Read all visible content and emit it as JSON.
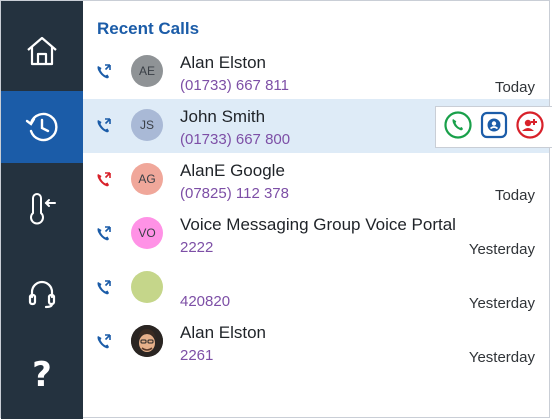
{
  "sidebar": {
    "items": [
      {
        "icon": "home-icon"
      },
      {
        "icon": "recent-calls-icon",
        "active": true
      },
      {
        "icon": "thermometer-icon"
      },
      {
        "icon": "headset-icon"
      },
      {
        "icon": "help-icon",
        "label": "?"
      }
    ]
  },
  "main": {
    "title": "Recent Calls",
    "calls": [
      {
        "name": "Alan Elston",
        "number": "(01733) 667 811",
        "when": "Today",
        "initials": "AE",
        "avatar_color": "#8f9396",
        "direction": "incoming",
        "icon_color": "#1b5ca8"
      },
      {
        "name": "John Smith",
        "number": "(01733) 667 800",
        "when": "",
        "initials": "JS",
        "avatar_color": "#a9b9d6",
        "direction": "incoming",
        "icon_color": "#1b5ca8",
        "highlighted": true
      },
      {
        "name": "AlanE Google",
        "number": "(07825) 112 378",
        "when": "Today",
        "initials": "AG",
        "avatar_color": "#f0a79a",
        "direction": "missed",
        "icon_color": "#d8212a"
      },
      {
        "name": "Voice Messaging Group Voice Portal",
        "number": "2222",
        "when": "Yesterday",
        "initials": "VO",
        "avatar_color": "#ff92e6",
        "direction": "incoming",
        "icon_color": "#1b5ca8"
      },
      {
        "name": "",
        "number": "420820",
        "when": "Yesterday",
        "initials": "",
        "avatar_color": "#c5d68a",
        "direction": "incoming",
        "icon_color": "#1b5ca8"
      },
      {
        "name": "Alan Elston",
        "number": "2261",
        "when": "Yesterday",
        "initials": "",
        "avatar_color": "#2b2b2b",
        "direction": "incoming",
        "icon_color": "#1b5ca8",
        "photo": true
      }
    ],
    "row_actions": [
      {
        "icon": "call-icon",
        "color": "#19a04a"
      },
      {
        "icon": "contact-card-icon",
        "color": "#1b5ca8"
      },
      {
        "icon": "add-contact-icon",
        "color": "#d8212a"
      }
    ]
  }
}
